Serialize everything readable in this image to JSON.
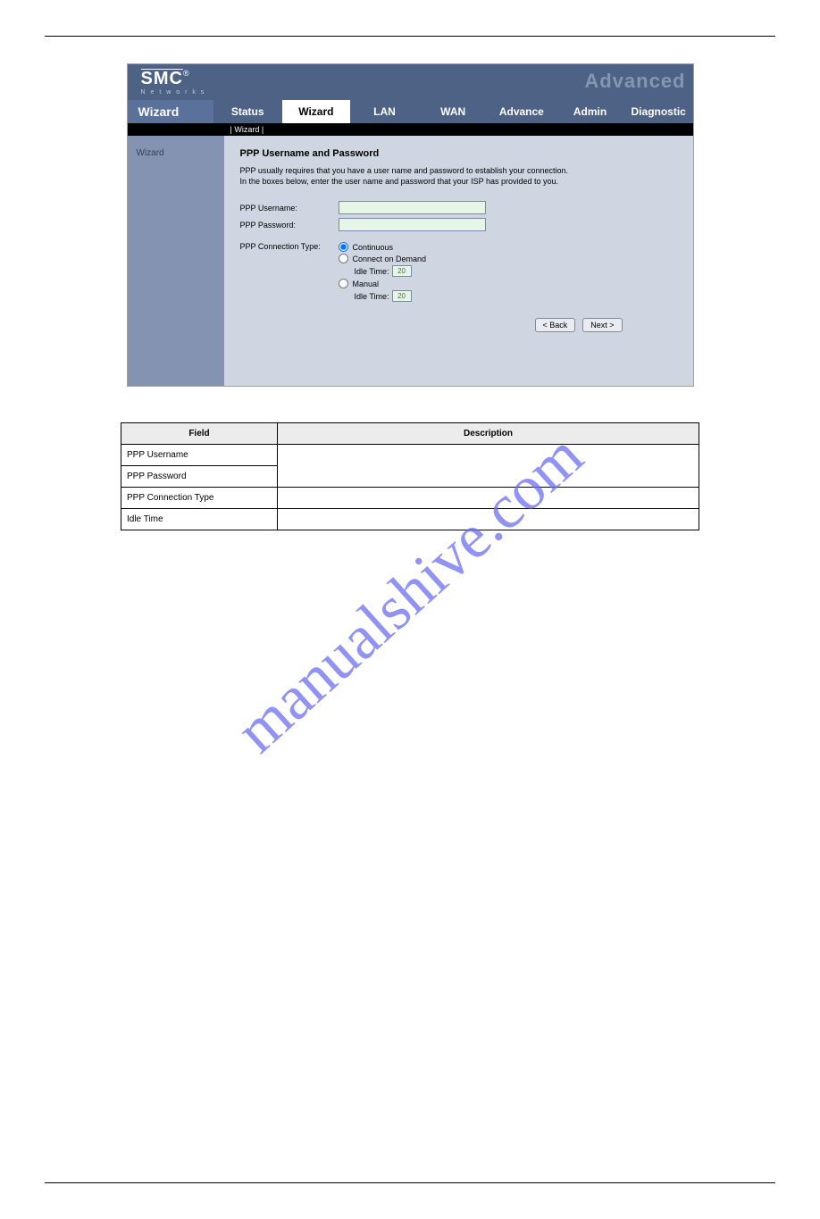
{
  "logo": {
    "text": "SMC",
    "sup": "®",
    "sub": "N e t w o r k s"
  },
  "banner_right": "Advanced",
  "nav": {
    "primary": "Wizard",
    "items": [
      "Status",
      "Wizard",
      "LAN",
      "WAN",
      "Advance",
      "Admin",
      "Diagnostic"
    ],
    "active_index": 1
  },
  "subnav": "| Wizard |",
  "sidebar": {
    "item": "Wizard"
  },
  "content": {
    "heading": "PPP Username and Password",
    "intro1": "PPP usually requires that you have a user name and password to establish your connection.",
    "intro2": "In the boxes below, enter the user name and password that your ISP has provided to you.",
    "username_label": "PPP Username:",
    "password_label": "PPP Password:",
    "username_value": "",
    "password_value": "",
    "conn_label": "PPP Connection Type:",
    "opt_continuous": "Continuous",
    "opt_demand": "Connect on Demand",
    "opt_manual": "Manual",
    "idle_label": "Idle Time:",
    "idle_demand": "20",
    "idle_manual": "20",
    "back_btn": "< Back",
    "next_btn": "Next >"
  },
  "table": {
    "head1": "Field",
    "head2": "Description",
    "row1c1": "PPP Username",
    "row2c1": "PPP Password",
    "row3c1": "PPP Connection Type",
    "row4c1": "Idle Time"
  },
  "watermark": "manualshive.com"
}
